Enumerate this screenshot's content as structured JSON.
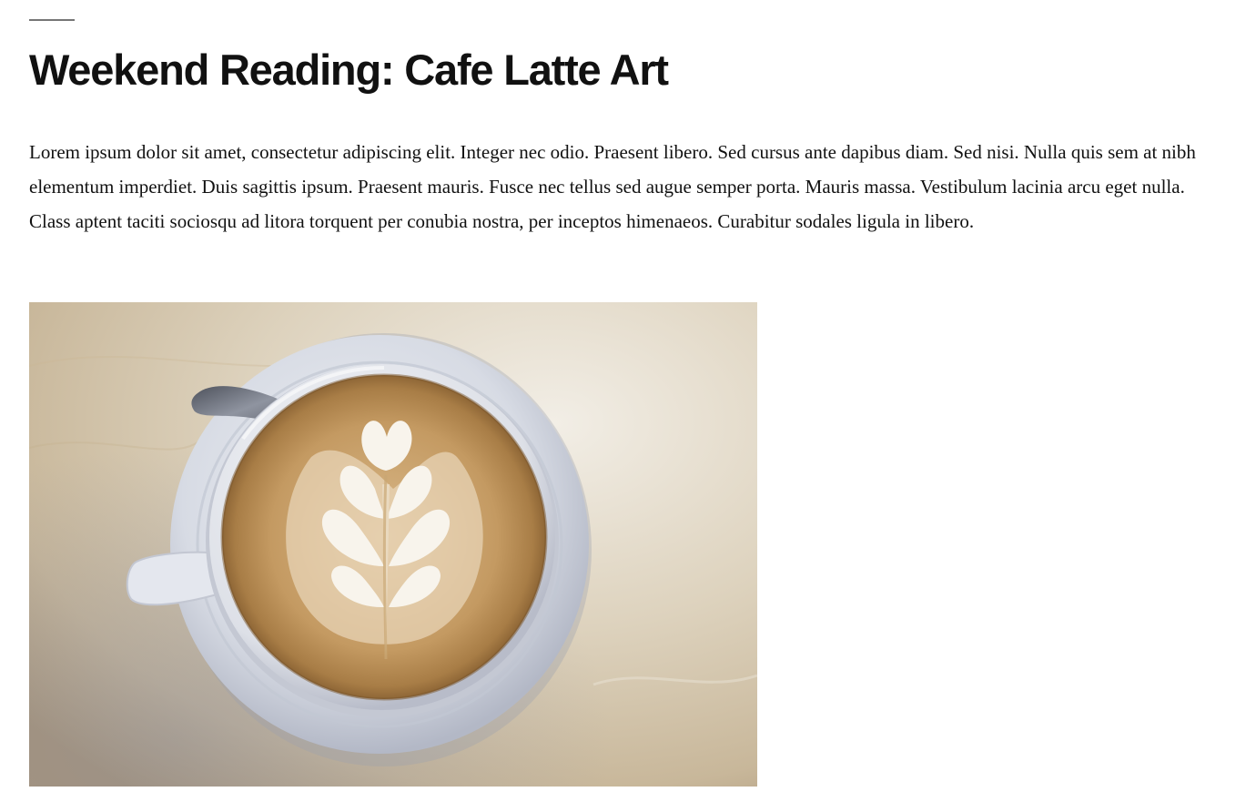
{
  "post": {
    "title": "Weekend Reading: Cafe Latte Art",
    "body": "Lorem ipsum dolor sit amet, consectetur adipiscing elit. Integer nec odio. Praesent libero. Sed cursus ante dapibus diam. Sed nisi. Nulla quis sem at nibh elementum imperdiet. Duis sagittis ipsum. Praesent mauris. Fusce nec tellus sed augue semper porta. Mauris massa. Vestibulum lacinia arcu eget nulla. Class aptent taciti sociosqu ad litora torquent per conubia nostra, per inceptos himenaeos. Curabitur sodales ligula in libero.",
    "image": {
      "subject": "latte-art-coffee-cup",
      "colors": {
        "table": "#d9cdb8",
        "saucer": "#d4d8e0",
        "cup": "#e6e9ef",
        "crema": "#b98a52",
        "foam": "#f7f3ec",
        "spoon": "#6d717b"
      }
    }
  }
}
